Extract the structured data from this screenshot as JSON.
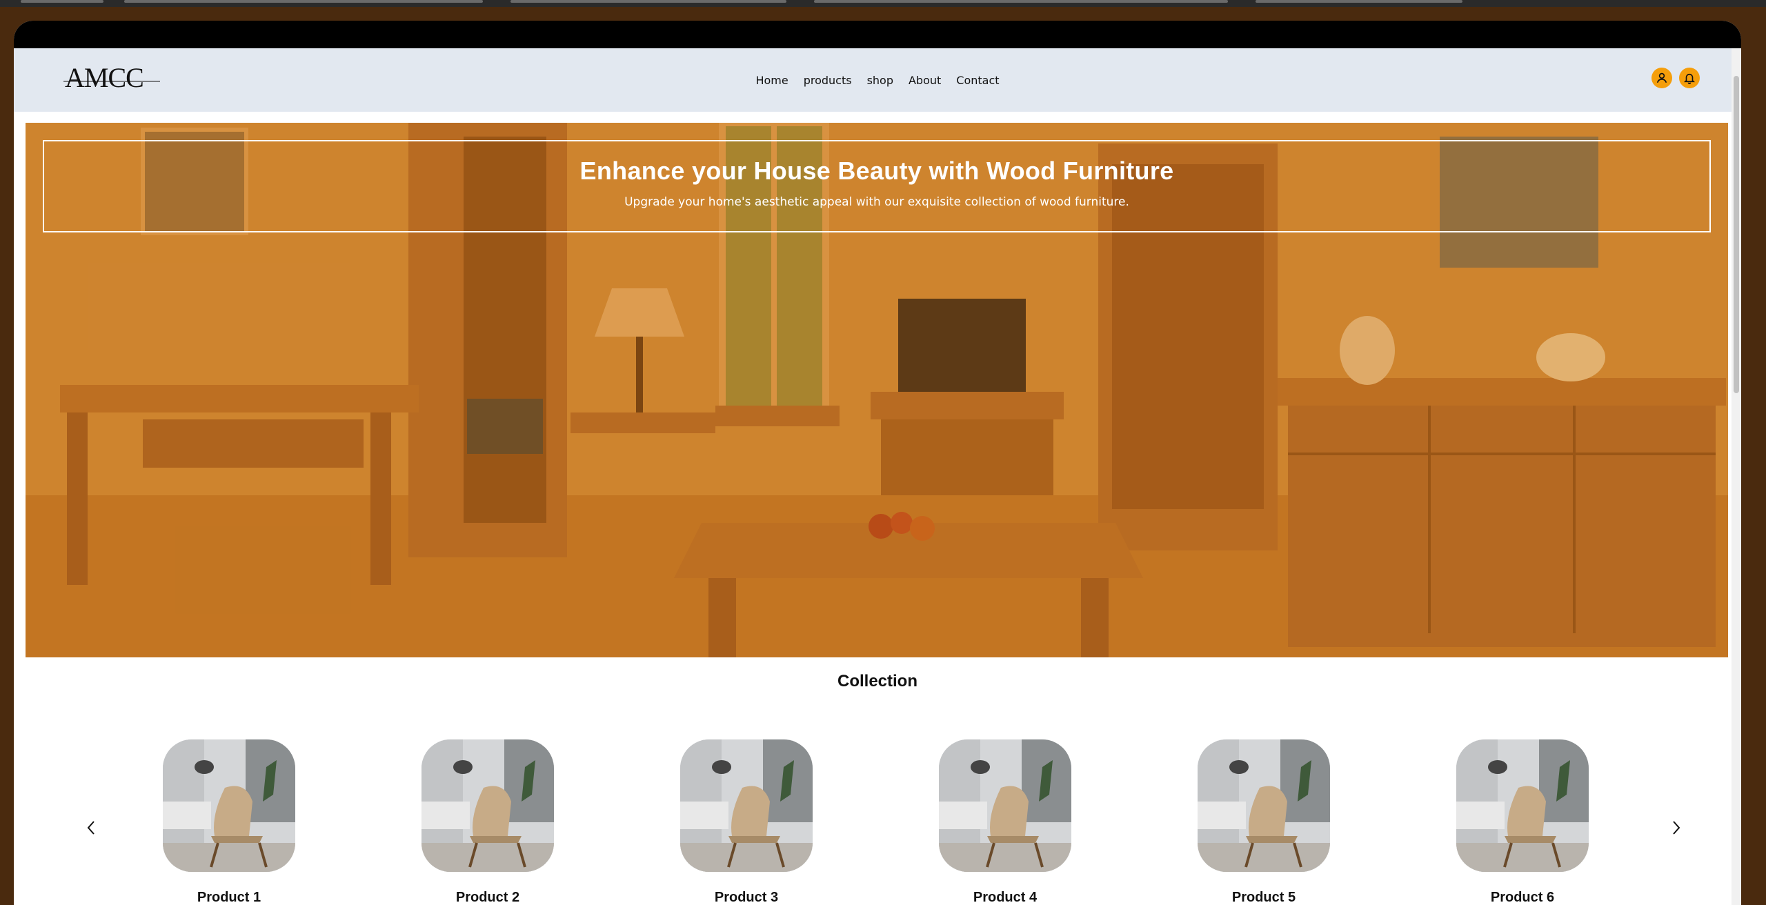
{
  "brand": {
    "logo_text": "AMCC"
  },
  "nav": {
    "links": [
      "Home",
      "products",
      "shop",
      "About",
      "Contact"
    ],
    "icons": [
      "user-icon",
      "bell-icon"
    ]
  },
  "colors": {
    "accent": "#f59e0b",
    "nav_bg": "#e2e8f0",
    "hero_tint": "#d67814"
  },
  "hero": {
    "title": "Enhance your House Beauty with Wood Furniture",
    "subtitle": "Upgrade your home's aesthetic appeal with our exquisite collection of wood furniture."
  },
  "collection": {
    "title": "Collection",
    "products": [
      "Product 1",
      "Product 2",
      "Product 3",
      "Product 4",
      "Product 5",
      "Product 6"
    ],
    "prev_icon": "chevron-left-icon",
    "next_icon": "chevron-right-icon"
  }
}
